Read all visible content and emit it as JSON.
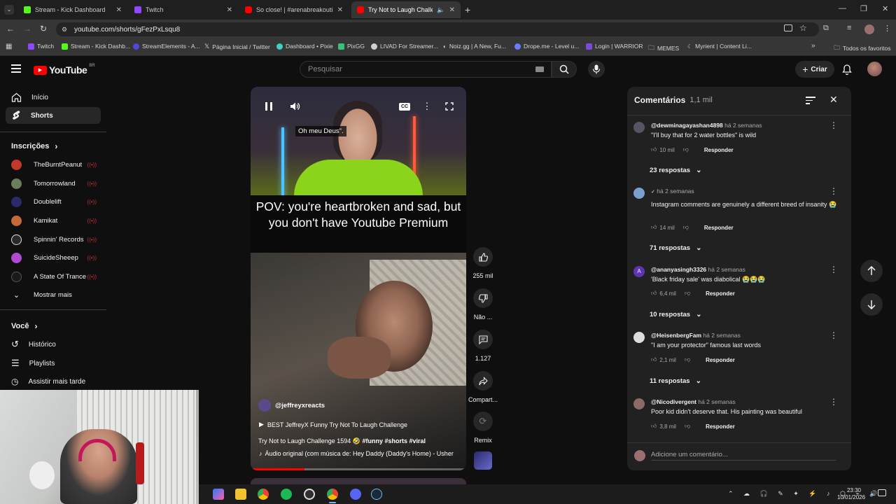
{
  "browser": {
    "tabs": [
      {
        "title": "Stream - Kick Dashboard",
        "color": "#53fc18"
      },
      {
        "title": "Twitch",
        "color": "#9146ff"
      },
      {
        "title": "So close! | #arenabreakoutinfin",
        "color": "#ff0000"
      },
      {
        "title": "Try Not to Laugh Challeng",
        "color": "#ff0000"
      }
    ],
    "url": "youtube.com/shorts/gFezPxLsqu8",
    "bookmarks": [
      {
        "label": "Twitch",
        "color": "#9146ff"
      },
      {
        "label": "Stream - Kick Dashb...",
        "color": "#53fc18"
      },
      {
        "label": "StreamElements - A...",
        "color": "#4a4adf"
      },
      {
        "label": "Página Inicial / Twitter",
        "color": "#e7e7e7"
      },
      {
        "label": "Dashboard • Pixie",
        "color": "#3ad1c6"
      },
      {
        "label": "PixGG",
        "color": "#36c27a"
      },
      {
        "label": "LIVAD For Streamer...",
        "color": "#cfcfcf"
      },
      {
        "label": "Noiz.gg | A New, Fu...",
        "color": "#dddddd"
      },
      {
        "label": "Drope.me - Level u...",
        "color": "#6b7cff"
      },
      {
        "label": "Login | WARRIOR",
        "color": "#7b4ad9"
      },
      {
        "label": "MEMES",
        "color": "#bdbdbd"
      },
      {
        "label": "Myrient | Content Li...",
        "color": "#aaaaaa"
      }
    ],
    "all_bookmarks": "Todos os favoritos"
  },
  "youtube": {
    "logo": "YouTube",
    "region": "BR",
    "search_placeholder": "Pesquisar",
    "create_label": "Criar"
  },
  "sidebar": {
    "home": "Início",
    "shorts": "Shorts",
    "subscriptions_title": "Inscrições",
    "channels": [
      {
        "name": "TheBurntPeanut",
        "color": "#c0392b"
      },
      {
        "name": "Tomorrowland",
        "color": "#6b7d5a"
      },
      {
        "name": "Doublelift",
        "color": "#2b2b6b"
      },
      {
        "name": "Kamikat",
        "color": "#c46a3a"
      },
      {
        "name": "Spinnin' Records",
        "color": "#2a2a2a"
      },
      {
        "name": "SuicideSheeep",
        "color": "#b04ad1"
      },
      {
        "name": "A State Of Trance",
        "color": "#1a1a1a"
      }
    ],
    "show_more": "Mostrar mais",
    "you_title": "Você",
    "history": "Histórico",
    "playlists": "Playlists",
    "watch_later": "Assistir mais tarde"
  },
  "short": {
    "subtitle": "Oh meu Deus\".",
    "caption": "POV: you're heartbroken and sad, but you don't have Youtube Premium",
    "channel": "@jeffreyxreacts",
    "playlist": "BEST JeffreyX Funny Try Not To Laugh Challenge",
    "title": "Try Not to Laugh Challenge 1594",
    "hashtags": "#funny #shorts #viral",
    "audio": "Áudio original (com música de: Hey Daddy (Daddy's Home) - Usher",
    "likes": "255 mil",
    "dislike": "Não ...",
    "comments": "1.127",
    "share": "Compart...",
    "remix": "Remix"
  },
  "comments": {
    "title": "Comentários",
    "count": "1,1 mil",
    "add_placeholder": "Adicione um comentário...",
    "reply_label": "Responder",
    "items": [
      {
        "author": "@dewminagayashan4898",
        "when": "há 2 semanas",
        "text": "\"I'll buy that for 2 water bottles\" is wild",
        "likes": "10 mil",
        "replies": "23 respostas",
        "color": "#556"
      },
      {
        "author": "",
        "when": "há 2 semanas",
        "text": "Instagram comments are genuinely a different breed of insanity 😭",
        "likes": "14 mil",
        "replies": "71 respostas",
        "color": "#7aa0d0"
      },
      {
        "author": "@ananyasingh3326",
        "when": "há 2 semanas",
        "text": "'Black friday sale' was diabolical 😭😭😭",
        "likes": "6,4 mil",
        "replies": "10 respostas",
        "color": "#5e35b1"
      },
      {
        "author": "@HeisenbergFam",
        "when": "há 2 semanas",
        "text": "\"I am your protector\" famous last words",
        "likes": "2,1 mil",
        "replies": "11 respostas",
        "color": "#ddd"
      },
      {
        "author": "@Nicodivergent",
        "when": "há 2 semanas",
        "text": "Poor kid didn't deserve that. His painting was beautiful",
        "likes": "3,8 mil",
        "replies": "",
        "color": "#8a6a6a"
      }
    ]
  },
  "taskbar": {
    "time": "23:30",
    "date": "10/01/2026"
  }
}
